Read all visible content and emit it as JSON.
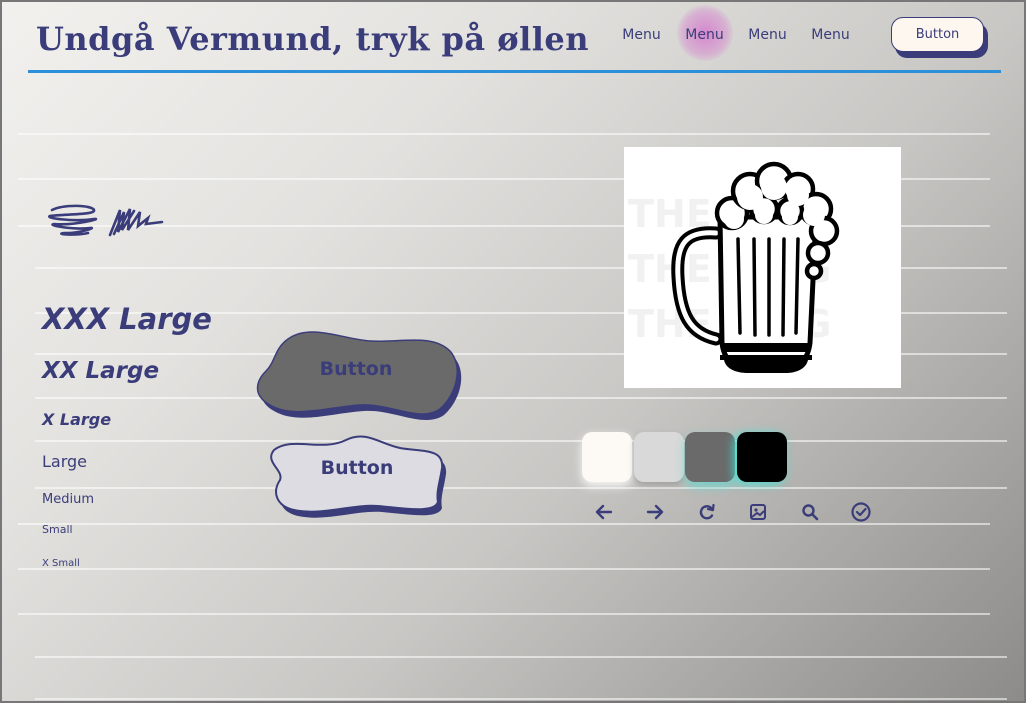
{
  "header": {
    "title": "Undgå Vermund, tryk på øllen",
    "nav": [
      "Menu",
      "Menu",
      "Menu",
      "Menu"
    ],
    "active_nav_index": 1,
    "button_label": "Button"
  },
  "typography": {
    "xxx_large": "XXX Large",
    "xx_large": "XX Large",
    "x_large": "X Large",
    "large": "Large",
    "medium": "Medium",
    "small": "Small",
    "x_small": "X Small"
  },
  "buttons": {
    "filled_label": "Button",
    "outline_label": "Button"
  },
  "image": {
    "subject": "beer-mug"
  },
  "palette": [
    "#fdf9f4",
    "#d9d9d9",
    "#6a6a6a",
    "#000000"
  ],
  "icons": [
    "arrow-left-icon",
    "arrow-right-icon",
    "refresh-icon",
    "image-icon",
    "search-icon",
    "check-circle-icon"
  ],
  "colors": {
    "primary": "#3a3d7a",
    "accent": "#2b8fd9",
    "highlight": "#d578cd"
  }
}
